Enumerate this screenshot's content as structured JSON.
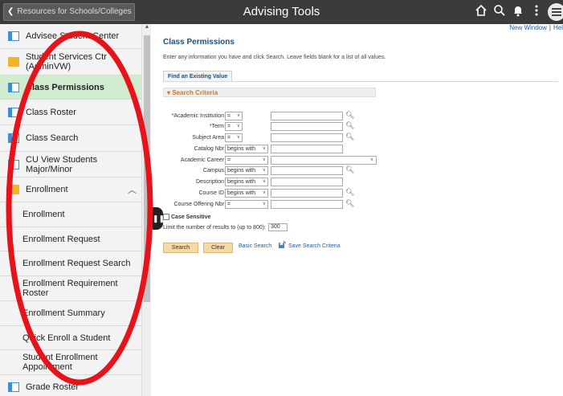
{
  "topbar": {
    "back_label": "Resources for Schools/Colleges",
    "title": "Advising Tools",
    "icons": [
      "home-icon",
      "search-icon",
      "bell-icon",
      "more-vertical-icon",
      "menu-icon"
    ]
  },
  "sidebar": {
    "items": [
      {
        "label": "Advisee Student Center",
        "icon": "page-icon"
      },
      {
        "label": "Student Services Ctr (AdminVW)",
        "icon": "folder-icon"
      },
      {
        "label": "Class Permissions",
        "icon": "page-icon",
        "active": true
      },
      {
        "label": "Class Roster",
        "icon": "page-icon"
      },
      {
        "label": "Class Search",
        "icon": "page-icon"
      },
      {
        "label": "CU View Students Major/Minor",
        "icon": "page-icon"
      },
      {
        "label": "Enrollment",
        "icon": "folder-icon",
        "expanded": true
      },
      {
        "label": "Enrollment"
      },
      {
        "label": "Enrollment Request"
      },
      {
        "label": "Enrollment Request Search"
      },
      {
        "label": "Enrollment Requirement Roster"
      },
      {
        "label": "Enrollment Summary"
      },
      {
        "label": "Quick Enroll a Student"
      },
      {
        "label": "Student Enrollment Appointment"
      },
      {
        "label": "Grade Roster",
        "icon": "page-icon"
      }
    ]
  },
  "header_links": {
    "new_window": "New Window",
    "help": "Hel"
  },
  "page": {
    "title": "Class Permissions",
    "instructions": "Enter any information you have and click Search. Leave fields blank for a list of all values.",
    "tab": "Find an Existing Value",
    "criteria_header": "Search Criteria"
  },
  "criteria": [
    {
      "label": "*Academic Institution",
      "op": "="
    },
    {
      "label": "*Term",
      "op": "="
    },
    {
      "label": "Subject Area",
      "op": "="
    },
    {
      "label": "Catalog Nbr",
      "op": "begins with"
    },
    {
      "label": "Academic Career",
      "op": "="
    },
    {
      "label": "Campus",
      "op": "begins with"
    },
    {
      "label": "Description",
      "op": "begins with"
    },
    {
      "label": "Course ID",
      "op": "begins with"
    },
    {
      "label": "Course Offering Nbr",
      "op": "="
    }
  ],
  "options": {
    "case_sensitive": "Case Sensitive",
    "limit_label": "Limit the number of results to (up to 800):",
    "limit_value": "300"
  },
  "buttons": {
    "search": "Search",
    "clear": "Clear",
    "basic_search": "Basic Search",
    "save_criteria": "Save Search Criteria"
  },
  "colors": {
    "annotation": "#e8121b",
    "active_item": "#cfeccf",
    "button": "#f5d9a6",
    "link": "#1f5fa8"
  }
}
